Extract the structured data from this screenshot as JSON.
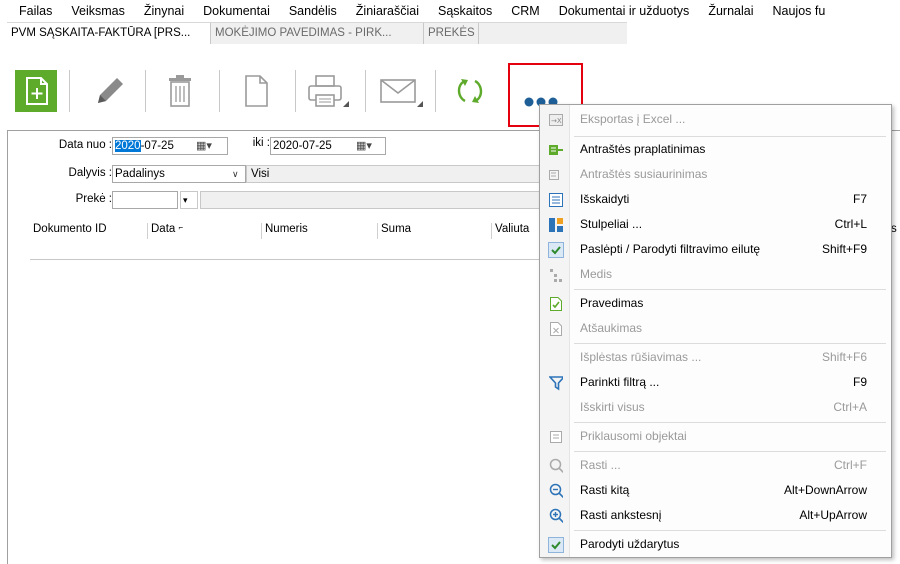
{
  "menu": [
    "Failas",
    "Veiksmas",
    "Žinynai",
    "Dokumentai",
    "Sandėlis",
    "Žiniaraščiai",
    "Sąskaitos",
    "CRM",
    "Dokumentai ir užduotys",
    "Žurnalai",
    "Naujos fu"
  ],
  "tabs": [
    {
      "label": "PVM SĄSKAITA-FAKTŪRA [PRS..."
    },
    {
      "label": "MOKĖJIMO PAVEDIMAS - PIRK..."
    },
    {
      "label": "PREKĖS"
    }
  ],
  "toolbar_icons": [
    "new-document-icon",
    "edit-pencil-icon",
    "delete-trash-icon",
    "copy-document-icon",
    "print-icon",
    "email-icon",
    "refresh-icon",
    "more-options-icon"
  ],
  "filters": {
    "date_from_label": "Data nuo :",
    "date_from_year": "2020",
    "date_from_rest": "-07-25",
    "date_to_label": "iki :",
    "date_to_value": "2020-07-25",
    "dimension_label": "Dalyvis :",
    "dimension_value": "Padalinys",
    "dimension_value2": "Visi",
    "product_label": "Prekė :"
  },
  "grid": {
    "columns": [
      "Dokumento ID",
      "Data",
      "Numeris",
      "Suma",
      "Valiuta"
    ],
    "partial_column": "s"
  },
  "context_menu": [
    {
      "label": "Eksportas į Excel ...",
      "shortcut": "",
      "disabled": true,
      "icon": "export-excel-icon"
    },
    {
      "label": "Antraštės praplatinimas",
      "shortcut": "",
      "disabled": false,
      "icon": "expand-header-icon"
    },
    {
      "label": "Antraštės susiaurinimas",
      "shortcut": "",
      "disabled": true,
      "icon": "collapse-header-icon"
    },
    {
      "label": "Išskaidyti",
      "shortcut": "F7",
      "disabled": false,
      "icon": "split-icon"
    },
    {
      "label": "Stulpeliai ...",
      "shortcut": "Ctrl+L",
      "disabled": false,
      "icon": "columns-icon"
    },
    {
      "label": "Paslėpti / Parodyti filtravimo eilutę",
      "shortcut": "Shift+F9",
      "disabled": false,
      "icon": "checkmark-icon"
    },
    {
      "label": "Medis",
      "shortcut": "",
      "disabled": true,
      "icon": "tree-icon"
    },
    {
      "label": "Pravedimas",
      "shortcut": "",
      "disabled": false,
      "icon": "post-document-icon"
    },
    {
      "label": "Atšaukimas",
      "shortcut": "",
      "disabled": true,
      "icon": "cancel-document-icon"
    },
    {
      "label": "Išplėstas rūšiavimas ...",
      "shortcut": "Shift+F6",
      "disabled": true,
      "icon": ""
    },
    {
      "label": "Parinkti filtrą ...",
      "shortcut": "F9",
      "disabled": false,
      "icon": "filter-icon"
    },
    {
      "label": "Išskirti visus",
      "shortcut": "Ctrl+A",
      "disabled": true,
      "icon": ""
    },
    {
      "label": "Priklausomi objektai",
      "shortcut": "",
      "disabled": true,
      "icon": "dependent-objects-icon"
    },
    {
      "label": "Rasti ...",
      "shortcut": "Ctrl+F",
      "disabled": true,
      "icon": "search-icon"
    },
    {
      "label": "Rasti kitą",
      "shortcut": "Alt+DownArrow",
      "disabled": false,
      "icon": "find-next-icon"
    },
    {
      "label": "Rasti ankstesnį",
      "shortcut": "Alt+UpArrow",
      "disabled": false,
      "icon": "find-previous-icon"
    },
    {
      "label": "Parodyti uždarytus",
      "shortcut": "",
      "disabled": false,
      "icon": "checkmark-icon"
    }
  ],
  "colors": {
    "accent_green": "#5eaa2b",
    "highlight_red": "#e4000f",
    "selection_blue": "#0078d7"
  }
}
